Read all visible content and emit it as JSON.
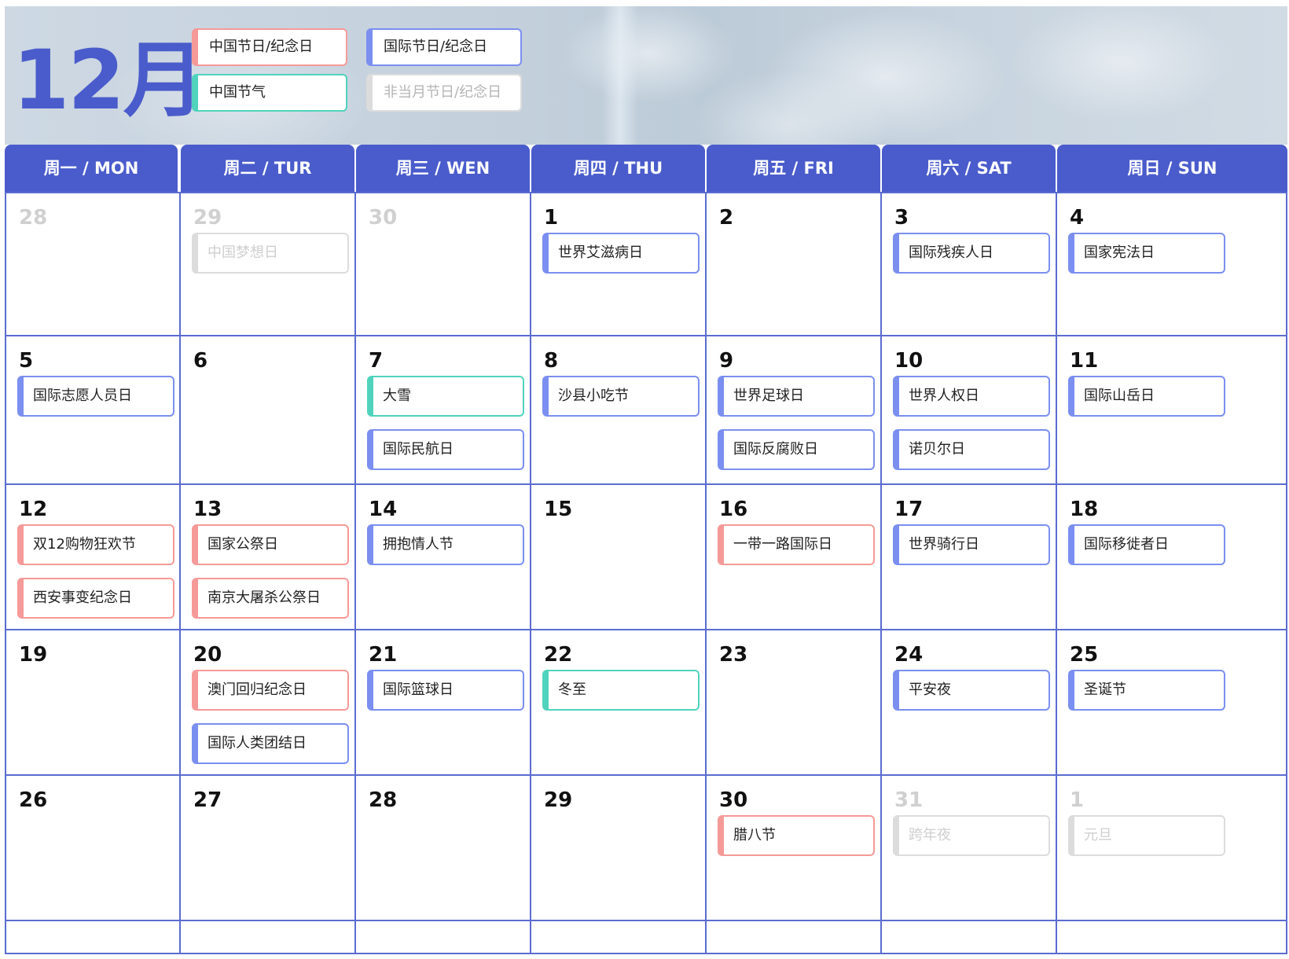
{
  "title": "12月",
  "colors": {
    "accent": "#4a5ccb",
    "international": "#7b8ff0",
    "chinese": "#f59a98",
    "solar_term": "#50d3bd",
    "other_month": "#dcdcdc"
  },
  "legend": [
    {
      "label": "中国节日/纪念日",
      "kind": "cn"
    },
    {
      "label": "国际节日/纪念日",
      "kind": "intl"
    },
    {
      "label": "中国节气",
      "kind": "term"
    },
    {
      "label": "非当月节日/纪念日",
      "kind": "other"
    }
  ],
  "weekdays": [
    "周一 / MON",
    "周二 / TUR",
    "周三 / WEN",
    "周四 / THU",
    "周五 / FRI",
    "周六 / SAT",
    "周日 / SUN"
  ],
  "weeks": [
    [
      {
        "day": "28",
        "muted": true,
        "events": []
      },
      {
        "day": "29",
        "muted": true,
        "events": [
          {
            "label": "中国梦想日",
            "kind": "other"
          }
        ]
      },
      {
        "day": "30",
        "muted": true,
        "events": []
      },
      {
        "day": "1",
        "events": [
          {
            "label": "世界艾滋病日",
            "kind": "intl"
          }
        ]
      },
      {
        "day": "2",
        "events": []
      },
      {
        "day": "3",
        "events": [
          {
            "label": "国际残疾人日",
            "kind": "intl"
          }
        ]
      },
      {
        "day": "4",
        "events": [
          {
            "label": "国家宪法日",
            "kind": "intl"
          }
        ]
      }
    ],
    [
      {
        "day": "5",
        "events": [
          {
            "label": "国际志愿人员日",
            "kind": "intl"
          }
        ]
      },
      {
        "day": "6",
        "events": []
      },
      {
        "day": "7",
        "events": [
          {
            "label": "大雪",
            "kind": "term"
          },
          {
            "label": "国际民航日",
            "kind": "intl"
          }
        ]
      },
      {
        "day": "8",
        "events": [
          {
            "label": "沙县小吃节",
            "kind": "intl"
          }
        ]
      },
      {
        "day": "9",
        "events": [
          {
            "label": "世界足球日",
            "kind": "intl"
          },
          {
            "label": "国际反腐败日",
            "kind": "intl"
          }
        ]
      },
      {
        "day": "10",
        "events": [
          {
            "label": "世界人权日",
            "kind": "intl"
          },
          {
            "label": "诺贝尔日",
            "kind": "intl"
          }
        ]
      },
      {
        "day": "11",
        "events": [
          {
            "label": "国际山岳日",
            "kind": "intl"
          }
        ]
      }
    ],
    [
      {
        "day": "12",
        "events": [
          {
            "label": "双12购物狂欢节",
            "kind": "cn"
          },
          {
            "label": "西安事变纪念日",
            "kind": "cn"
          }
        ]
      },
      {
        "day": "13",
        "events": [
          {
            "label": "国家公祭日",
            "kind": "cn"
          },
          {
            "label": "南京大屠杀公祭日",
            "kind": "cn"
          }
        ]
      },
      {
        "day": "14",
        "events": [
          {
            "label": "拥抱情人节",
            "kind": "intl"
          }
        ]
      },
      {
        "day": "15",
        "events": []
      },
      {
        "day": "16",
        "events": [
          {
            "label": "一带一路国际日",
            "kind": "cn"
          }
        ]
      },
      {
        "day": "17",
        "events": [
          {
            "label": "世界骑行日",
            "kind": "intl"
          }
        ]
      },
      {
        "day": "18",
        "events": [
          {
            "label": "国际移徙者日",
            "kind": "intl"
          }
        ]
      }
    ],
    [
      {
        "day": "19",
        "events": []
      },
      {
        "day": "20",
        "events": [
          {
            "label": "澳门回归纪念日",
            "kind": "cn"
          },
          {
            "label": "国际人类团结日",
            "kind": "intl"
          }
        ]
      },
      {
        "day": "21",
        "events": [
          {
            "label": "国际篮球日",
            "kind": "intl"
          }
        ]
      },
      {
        "day": "22",
        "events": [
          {
            "label": "冬至",
            "kind": "term"
          }
        ]
      },
      {
        "day": "23",
        "events": []
      },
      {
        "day": "24",
        "events": [
          {
            "label": "平安夜",
            "kind": "intl"
          }
        ]
      },
      {
        "day": "25",
        "events": [
          {
            "label": "圣诞节",
            "kind": "intl"
          }
        ]
      }
    ],
    [
      {
        "day": "26",
        "events": []
      },
      {
        "day": "27",
        "events": []
      },
      {
        "day": "28",
        "events": []
      },
      {
        "day": "29",
        "events": []
      },
      {
        "day": "30",
        "events": [
          {
            "label": "腊八节",
            "kind": "cn"
          }
        ]
      },
      {
        "day": "31",
        "muted": true,
        "events": [
          {
            "label": "跨年夜",
            "kind": "other"
          }
        ]
      },
      {
        "day": "1",
        "muted": true,
        "events": [
          {
            "label": "元旦",
            "kind": "other"
          }
        ]
      }
    ]
  ]
}
